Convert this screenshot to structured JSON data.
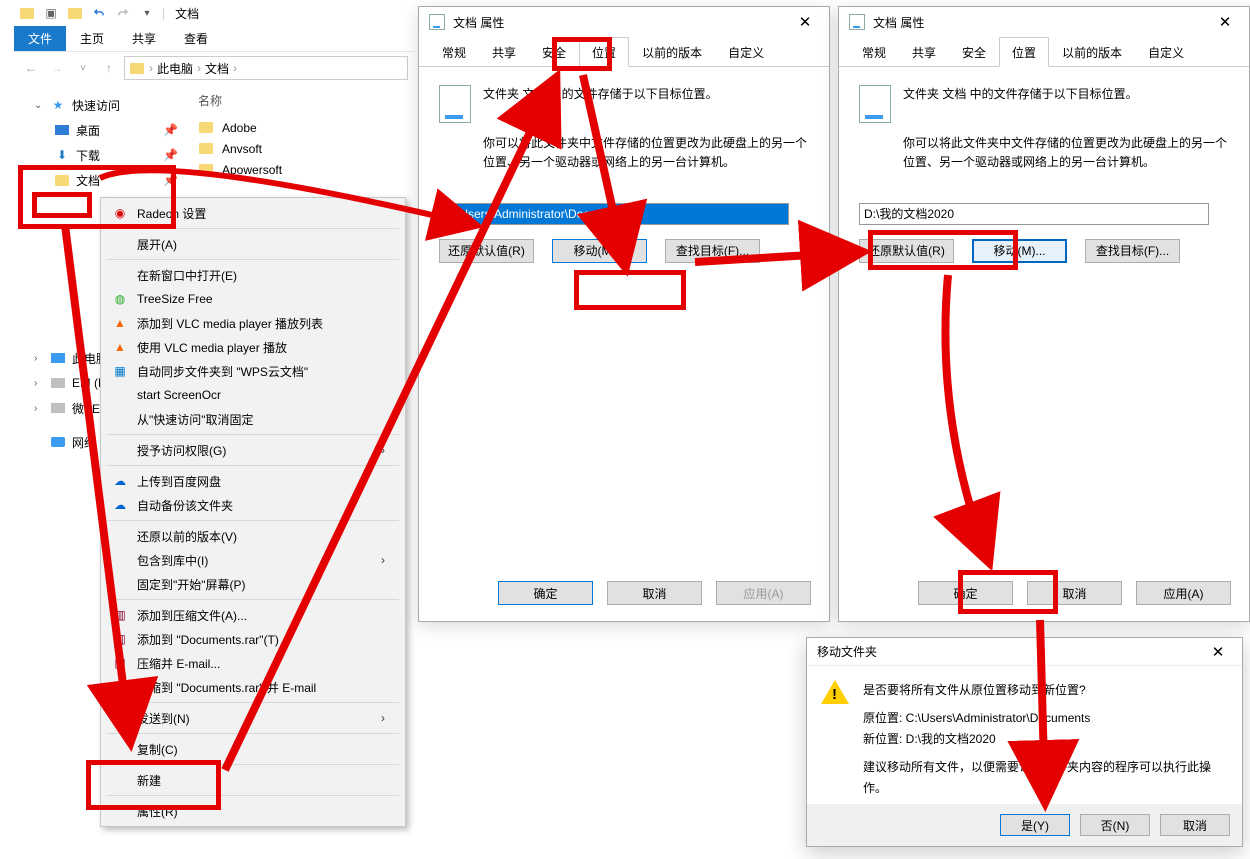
{
  "explorer": {
    "title": "文档",
    "ribbon": {
      "file": "文件",
      "home": "主页",
      "share": "共享",
      "view": "查看"
    },
    "breadcrumb": {
      "root": "此电脑",
      "current": "文档"
    },
    "list_header": "名称",
    "files": [
      "Adobe",
      "Anvsoft",
      "Apowersoft"
    ],
    "nav": {
      "quick": "快速访问",
      "desktop": "桌面",
      "downloads": "下载",
      "documents": "文档",
      "pc": "此电脑",
      "efi": "EFI (H:)",
      "winpe": "微PE工具",
      "network": "网络"
    }
  },
  "context_menu": {
    "radeon": "Radeon 设置",
    "expand": "展开(A)",
    "open_new": "在新窗口中打开(E)",
    "treesize": "TreeSize Free",
    "vlc_add": "添加到 VLC media player 播放列表",
    "vlc_play": "使用 VLC media player 播放",
    "wps_sync": "自动同步文件夹到 \"WPS云文档\"",
    "screenocr": "start ScreenOcr",
    "unpin_quick": "从\"快速访问\"取消固定",
    "grant_access": "授予访问权限(G)",
    "baidu_upload": "上传到百度网盘",
    "auto_backup": "自动备份该文件夹",
    "restore_prev": "还原以前的版本(V)",
    "include_lib": "包含到库中(I)",
    "pin_start": "固定到\"开始\"屏幕(P)",
    "rar_add": "添加到压缩文件(A)...",
    "rar_add_name": "添加到 \"Documents.rar\"(T)",
    "rar_email": "压缩并 E-mail...",
    "rar_email_name": "压缩到 \"Documents.rar\" 并 E-mail",
    "send_to": "发送到(N)",
    "copy": "复制(C)",
    "new": "新建",
    "properties": "属性(R)"
  },
  "properties": {
    "title": "文档 属性",
    "tabs": {
      "general": "常规",
      "share": "共享",
      "security": "安全",
      "location": "位置",
      "previous": "以前的版本",
      "custom": "自定义"
    },
    "desc1": "文件夹 文档 中的文件存储于以下目标位置。",
    "desc2a": "你可以将此文件夹中文件存储的位置更改为此硬盘上的另一个",
    "desc2b": "位置、另一个驱动器或网络上的另一台计算机。",
    "path1": "C:\\Users\\Administrator\\Documents",
    "path2": "D:\\我的文档2020",
    "restore": "还原默认值(R)",
    "move": "移动(M)...",
    "find": "查找目标(F)...",
    "ok": "确定",
    "cancel": "取消",
    "apply": "应用(A)"
  },
  "msgbox": {
    "title": "移动文件夹",
    "q": "是否要将所有文件从原位置移动到新位置?",
    "old": "原位置: C:\\Users\\Administrator\\Documents",
    "new": "新位置: D:\\我的文档2020",
    "advice": "建议移动所有文件，以便需要访问文件夹内容的程序可以执行此操作。",
    "yes": "是(Y)",
    "no": "否(N)",
    "cancel": "取消"
  }
}
